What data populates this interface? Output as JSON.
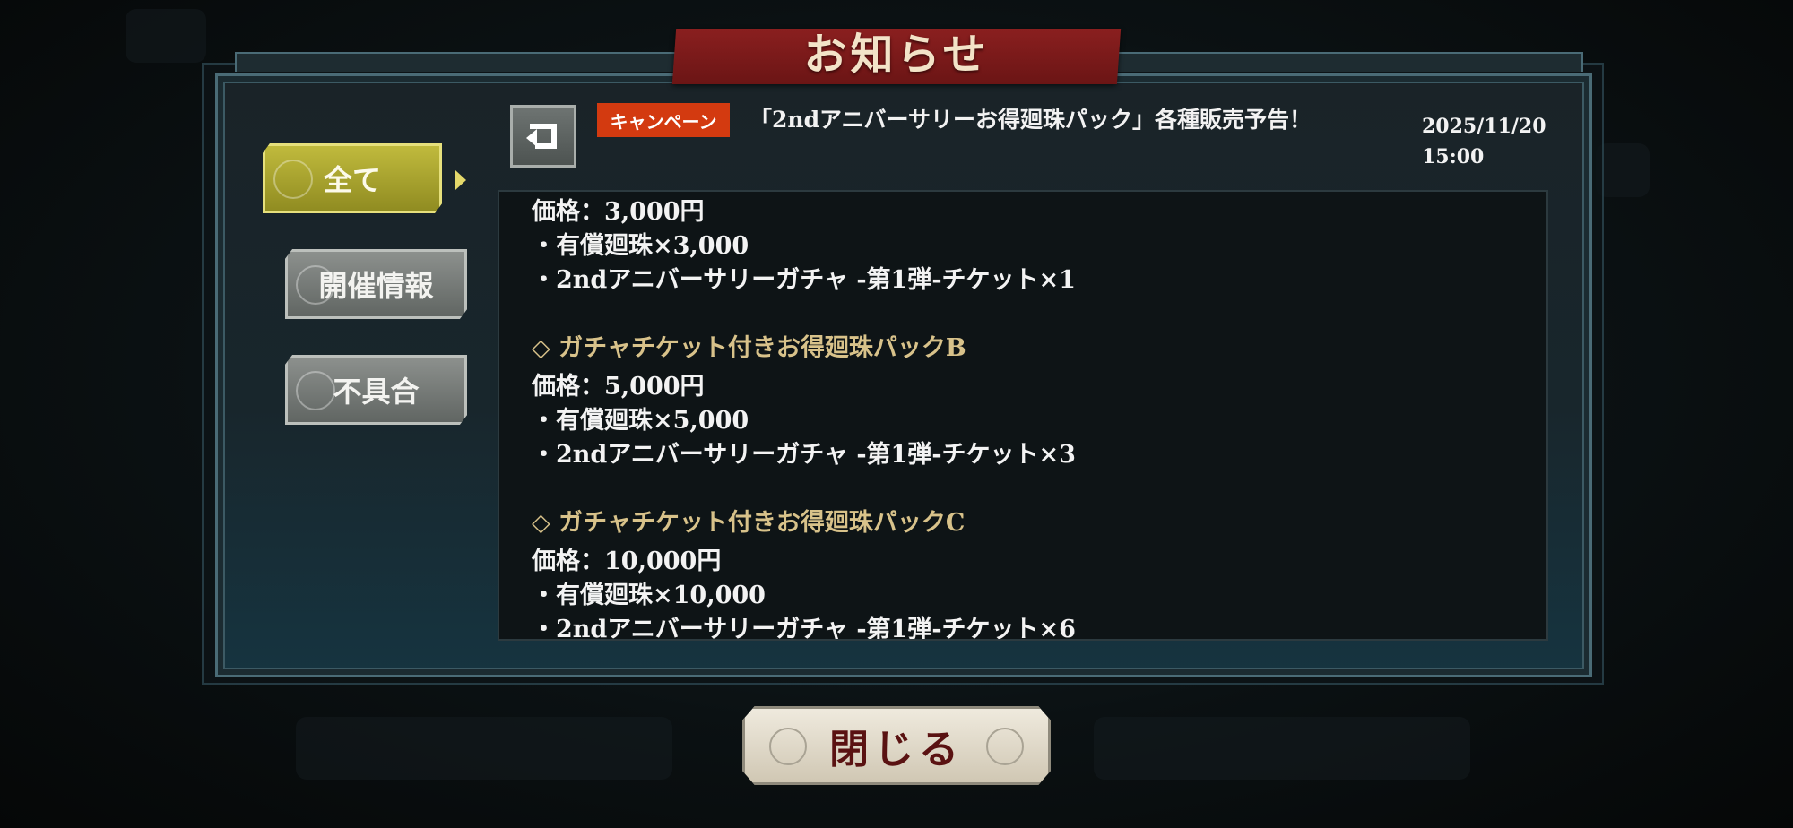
{
  "dialog": {
    "title": "お知らせ",
    "close_label": "閉じる"
  },
  "sidebar": {
    "items": [
      {
        "label": "全て",
        "active": true
      },
      {
        "label": "開催情報",
        "active": false
      },
      {
        "label": "不具合",
        "active": false
      }
    ]
  },
  "notice": {
    "tag": "キャンペーン",
    "title": "「2ndアニバーサリーお得廻珠パック」各種販売予告！",
    "date": "2025/11/20",
    "time": "15:00"
  },
  "body": {
    "lines": [
      "価格：3,000円",
      "・有償廻珠×3,000",
      "・2ndアニバーサリーガチャ -第1弾-チケット×1",
      "◇ ガチャチケット付きお得廻珠パックB",
      "価格：5,000円",
      "・有償廻珠×5,000",
      "・2ndアニバーサリーガチャ -第1弾-チケット×3",
      "◇ ガチャチケット付きお得廻珠パックC",
      "価格：10,000円",
      "・有償廻珠×10,000",
      "・2ndアニバーサリーガチャ -第1弾-チケット×6"
    ]
  },
  "colors": {
    "tag_bg": "#d33a10",
    "active_tab": "#b3ad35",
    "heading_text": "#d8c28a",
    "title_banner": "#7a1a1a"
  }
}
